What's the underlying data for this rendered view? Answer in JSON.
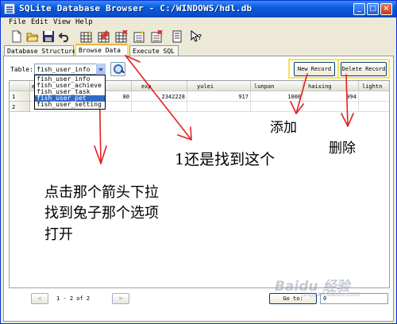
{
  "window": {
    "title": "SQLite Database Browser - C:/WINDOWS/hdl.db",
    "minimize": "_",
    "maximize": "□",
    "close": "×"
  },
  "menu": [
    "File",
    "Edit",
    "View",
    "Help"
  ],
  "toolbar": {
    "icons": [
      "new-db-icon",
      "open-db-icon",
      "save-icon",
      "undo-icon",
      "create-table-icon",
      "modify-table-icon",
      "delete-table-icon",
      "create-index-icon",
      "delete-index-icon",
      "sql-log-icon",
      "whats-this-icon"
    ]
  },
  "tabs": [
    "Database Structure",
    "Browse Data",
    "Execute SQL"
  ],
  "browse": {
    "table_label": "Table:",
    "selected_table": "fish_user_info",
    "options": [
      "fish_user_info",
      "fish_user_achieve",
      "fish_user_task",
      "fish_user_pet",
      "fish_user_setting"
    ],
    "highlighted_option": "fish_user_pet",
    "new_record": "New Record",
    "delete_record": "Delete Record"
  },
  "grid": {
    "columns": [
      "e",
      "exp",
      "yulei",
      "lunpan",
      "haixing",
      "lightn"
    ],
    "rows": [
      {
        "row": "1",
        "cells": [
          "80",
          "2342228",
          "917",
          "1000",
          "994",
          ""
        ]
      },
      {
        "row": "2",
        "cells": [
          "",
          "",
          "",
          "",
          "",
          ""
        ]
      }
    ]
  },
  "nav": {
    "prev": "<",
    "next": ">",
    "record_status": "1 - 2 of 2",
    "goto": "Go to:",
    "goto_value": "0"
  },
  "annotations": {
    "found_this": "1还是找到这个",
    "add": "添加",
    "delete": "删除",
    "instruction_line1": "点击那个箭头下拉",
    "instruction_line2": "找到兔子那个选项",
    "instruction_line3": "打开"
  },
  "watermark": {
    "logo": "Baidu 经验",
    "url": "jingyan.baidu.com"
  },
  "colors": {
    "titlebar": "#0a5cdc",
    "selection": "#316ac5",
    "annotation_red": "#e32020",
    "highlight_yellow": "#f3e35a",
    "active_tab": "#e68b2c"
  }
}
